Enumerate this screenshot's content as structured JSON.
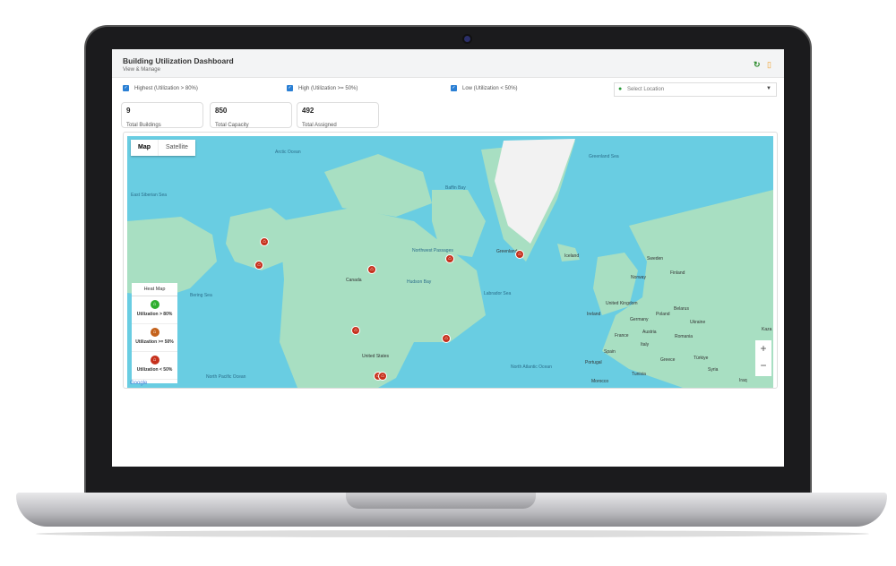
{
  "header": {
    "title": "Building Utilization Dashboard",
    "subtitle": "View & Manage",
    "refresh_icon": "↻",
    "bookmark_icon": "▯"
  },
  "filters": [
    {
      "label": "Highest (Utilization > 80%)",
      "checked": true
    },
    {
      "label": "High (Utilization >= 50%)",
      "checked": true
    },
    {
      "label": "Low (Utilization < 50%)",
      "checked": true
    }
  ],
  "location": {
    "placeholder": "Select Location"
  },
  "stats": [
    {
      "value": "9",
      "label": "Total Buildings"
    },
    {
      "value": "850",
      "label": "Total Capacity"
    },
    {
      "value": "492",
      "label": "Total Assigned"
    }
  ],
  "map": {
    "tabs": [
      "Map",
      "Satellite"
    ],
    "ocean_labels": [
      "Arctic Ocean",
      "East Siberian Sea",
      "Bering Sea",
      "North Pacific Ocean",
      "Baffin Bay",
      "Greenland Sea",
      "Hudson Bay",
      "Labrador Sea",
      "North Atlantic Ocean",
      "Northwest Passages"
    ],
    "country_labels": [
      "Canada",
      "United States",
      "Greenland",
      "Iceland",
      "Norway",
      "Sweden",
      "Finland",
      "United Kingdom",
      "Ireland",
      "Germany",
      "Poland",
      "Belarus",
      "Ukraine",
      "France",
      "Austria",
      "Romania",
      "Italy",
      "Spain",
      "Portugal",
      "Greece",
      "Türkiye",
      "Tunisia",
      "Syria",
      "Iraq",
      "Morocco",
      "Kaza"
    ],
    "legend": {
      "title": "Heat Map",
      "items": [
        {
          "label": "Utilization > 80%",
          "color": "#2fae2f"
        },
        {
          "label": "Utilization >= 50%",
          "color": "#c4621c"
        },
        {
          "label": "Utilization < 50%",
          "color": "#c6301c"
        }
      ]
    },
    "zoom_in": "+",
    "zoom_out": "−",
    "attribution": "Google"
  }
}
